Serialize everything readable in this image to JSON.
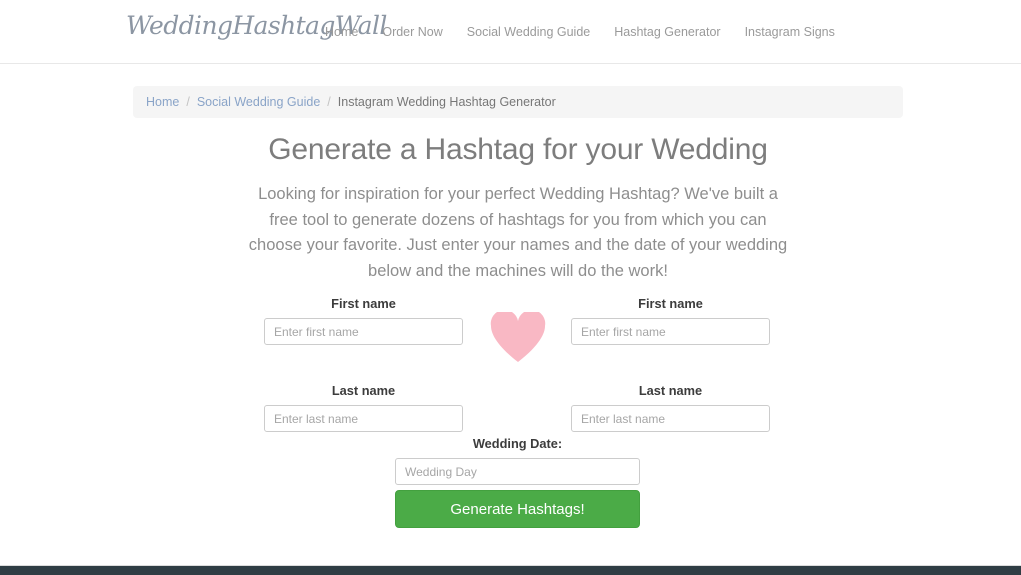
{
  "header": {
    "brand": "WeddingHashtagWall",
    "nav": [
      {
        "label": "Home"
      },
      {
        "label": "Order Now"
      },
      {
        "label": "Social Wedding Guide"
      },
      {
        "label": "Hashtag Generator"
      },
      {
        "label": "Instagram Signs"
      }
    ]
  },
  "breadcrumb": {
    "separator": "/",
    "items": [
      {
        "label": "Home",
        "current": false
      },
      {
        "label": "Social Wedding Guide",
        "current": false
      },
      {
        "label": "Instagram Wedding Hashtag Generator",
        "current": true
      }
    ]
  },
  "main": {
    "title": "Generate a Hashtag for your Wedding",
    "description": "Looking for inspiration for your perfect Wedding Hashtag? We've built a free tool to generate dozens of hashtags for you from which you can choose your favorite. Just enter your names and the date of your wedding below and the machines will do the work!"
  },
  "form": {
    "partner_one": {
      "first_name_label": "First name",
      "first_name_placeholder": "Enter first name",
      "first_name_value": "",
      "last_name_label": "Last name",
      "last_name_placeholder": "Enter last name",
      "last_name_value": ""
    },
    "partner_two": {
      "first_name_label": "First name",
      "first_name_placeholder": "Enter first name",
      "first_name_value": "",
      "last_name_label": "Last name",
      "last_name_placeholder": "Enter last name",
      "last_name_value": ""
    },
    "wedding_date": {
      "label": "Wedding Date:",
      "placeholder": "Wedding Day",
      "value": ""
    },
    "submit_label": "Generate Hashtags!",
    "heart_icon": "heart-icon"
  },
  "colors": {
    "heart": "#f9b8c4",
    "button": "#4bab47",
    "link": "#8aa4c8",
    "heading": "#7d7d7d",
    "footer": "#2f3d44"
  }
}
